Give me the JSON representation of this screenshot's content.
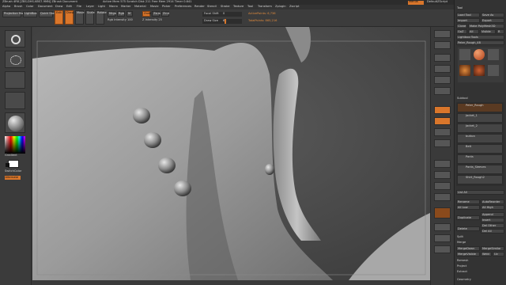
{
  "title": {
    "app": "ZBrush 4R8 [ZBS-DHS-KBS7-9MN]  ZBrush Document",
    "stats": "Active Mem 575  Scratch Disk 211  Free Mem 2914  Timer 0.641",
    "buttons": [
      "Menus",
      "DefaultZScript"
    ]
  },
  "menu": [
    "Alpha",
    "Brush",
    "Color",
    "Document",
    "Draw",
    "Edit",
    "File",
    "Layer",
    "Light",
    "Macro",
    "Marker",
    "Material",
    "Movie",
    "Picker",
    "Preferences",
    "Render",
    "Stencil",
    "Stroke",
    "Texture",
    "Tool",
    "Transform",
    "Zplugin",
    "Zscript"
  ],
  "toolbar": {
    "lightbox": "LightBox",
    "projection_master": "Projection Master",
    "quick_sketch": "Quick Sketch",
    "edit": "Edit",
    "draw": "Draw",
    "move": "Move",
    "scale": "Scale",
    "rotate": "Rotate",
    "mrgb": "Mrgb",
    "rgb": "Rgb",
    "m": "M",
    "zadd": "Zadd",
    "zsub": "Zsub",
    "zcut": "Zcut",
    "focal_shift_label": "Focal Shift",
    "focal_shift_value": "0",
    "draw_size_label": "Draw Size",
    "draw_size_value": "64",
    "active_points": "ActivePoints: 6,736",
    "total_points": "TotalPoints: 865,216",
    "z_intensity": "Z Intensity 25",
    "rgb_intensity": "Rgb Intensity 100"
  },
  "left_shelf": {
    "gradient_label": "Gradient",
    "switch_color_label": "SwitchColor",
    "alternate_label": "Alternate"
  },
  "right_shelf": {
    "labels": [
      "BPR",
      "SPix 3",
      "Scroll",
      "Zoom",
      "Actual",
      "AAHalf",
      "Persp",
      "Floor",
      "Local",
      "XYZ",
      "Frame",
      "Move",
      "Scale",
      "Rotate",
      "Line Fill",
      "PolyF",
      "Transp",
      "Solo",
      "Xpose"
    ]
  },
  "tool_panel": {
    "header": "Tool",
    "load_tool": "Load Tool",
    "save_as": "Save As",
    "import": "Import",
    "export": "Export",
    "clone": "Clone",
    "make_polymesh": "Make PolyMesh3D",
    "goz": "GoZ",
    "all": "All",
    "visible": "Visible",
    "r": "R",
    "lightbox_tools": "Lightbox›Tools",
    "current_tool": "Peter_Rough_48",
    "current_tool_value": "48",
    "subtool_header": "Subtool",
    "subtools": [
      "Peter_Rough",
      "Jacket_1",
      "Jacket_2",
      "button",
      "Belt",
      "Pants",
      "Pants_Sleeves",
      "Shirt_Rough2"
    ],
    "list_all": "List All",
    "rename": "Rename",
    "autoreorder": "AutoReorder",
    "all_low": "All Low",
    "all_high": "All High",
    "duplicate": "Duplicate",
    "append": "Append",
    "insert": "Insert",
    "delete": "Delete",
    "del_other": "Del Other",
    "del_all": "Del All",
    "split": "Split",
    "merge": "Merge",
    "merge_down": "MergeDown",
    "merge_similar": "MergeSimilar",
    "merge_visible": "MergeVisible",
    "weld": "Weld",
    "uv": "Uv",
    "remesh": "Remesh",
    "project": "Project",
    "extract": "Extract",
    "geometry": "Geometry"
  },
  "colors": {
    "accent": "#d9762b",
    "panel": "#333333",
    "viewport": "#4b4b4b"
  }
}
